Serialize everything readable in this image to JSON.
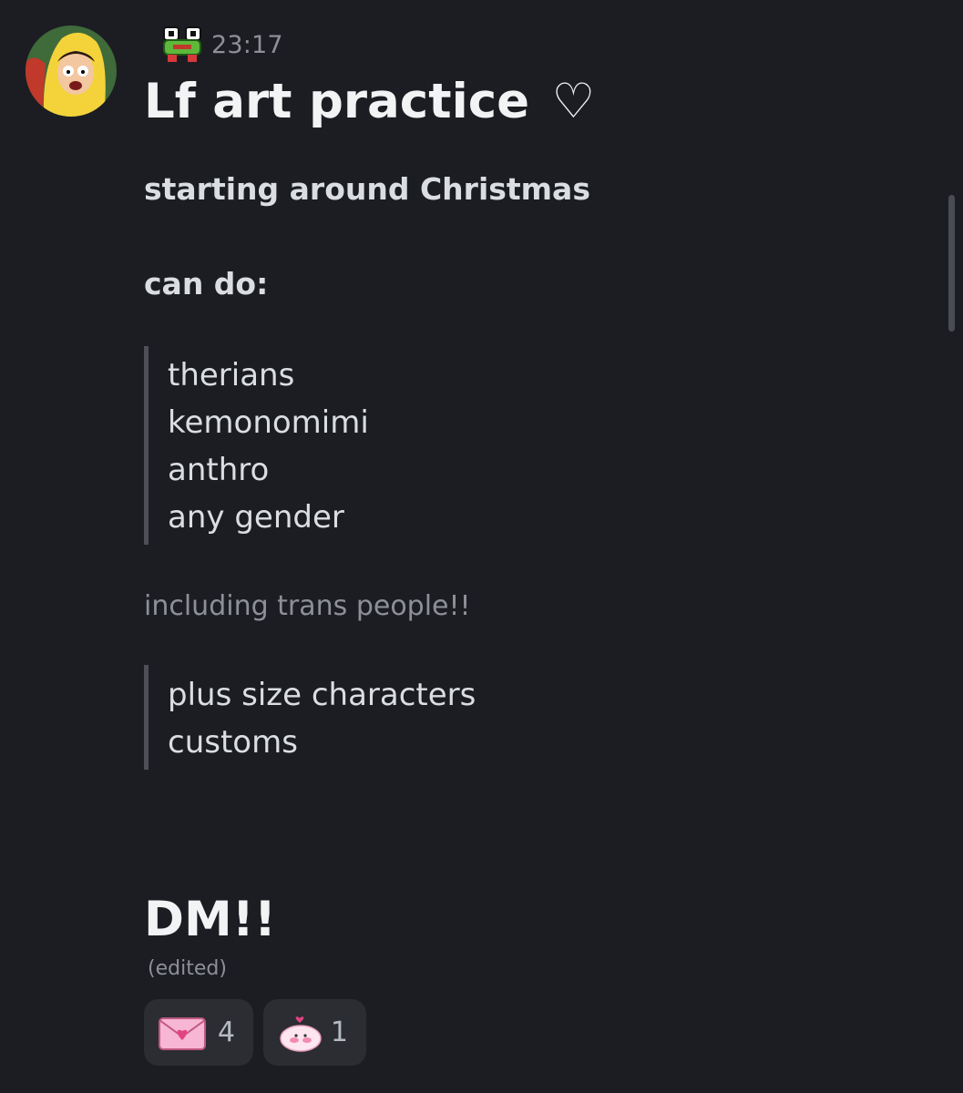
{
  "message": {
    "timestamp": "23:17",
    "title": "Lf art practice",
    "title_symbol": "♡",
    "line_starting": "starting around Christmas",
    "line_can_do": "can do:",
    "quote_1": [
      "therians",
      "kemonomimi",
      "anthro",
      "any gender"
    ],
    "subtext": "including trans people!!",
    "quote_2": [
      "plus size characters",
      "customs"
    ],
    "dm": "DM!!",
    "edited": "(edited)"
  },
  "reactions": [
    {
      "icon": "love-letter-icon",
      "count": "4"
    },
    {
      "icon": "pink-blob-icon",
      "count": "1"
    }
  ],
  "colors": {
    "background": "#1c1d22",
    "text": "#dbdee1",
    "muted": "#8d9097",
    "reaction_bg": "#2b2d33",
    "quote_bar": "#4e5058"
  }
}
